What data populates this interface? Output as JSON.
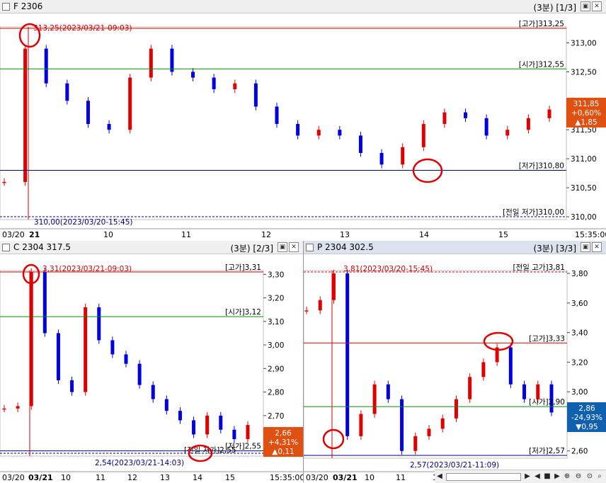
{
  "panels": {
    "top": {
      "name": "F 2306",
      "info": "(3분) [1/3]",
      "ylabels": [
        "313,00",
        "312,50",
        "312,00",
        "311,50",
        "311,00",
        "310,50",
        "310,00"
      ],
      "hlines": [
        {
          "label": "[고가]313,25",
          "value": 313.25,
          "color": "#d00000",
          "dash": false
        },
        {
          "label": "[시가]312,55",
          "value": 312.55,
          "color": "#009000",
          "dash": false
        },
        {
          "label": "[저가]310,80",
          "value": 310.8,
          "color": "#000080",
          "dash": false
        },
        {
          "label": "[전일 저가]310,00",
          "value": 310.0,
          "color": "#000080",
          "dash": true
        }
      ],
      "annotations": [
        "313,25(2023/03/21-09:03)",
        "310,00(2023/03/20-15:45)"
      ],
      "current": {
        "price": "311,85",
        "change": "+0,60%",
        "diff": "▲1,85"
      },
      "xlabels": [
        "03/20",
        "21",
        "10",
        "11",
        "12",
        "13",
        "14",
        "15",
        "15:35:00"
      ]
    },
    "c": {
      "name": "C 2304 317.5",
      "info": "(3분) [2/3]",
      "ylabels": [
        "3,30",
        "3,20",
        "3,10",
        "3,00",
        "2,90",
        "2,80",
        "2,70",
        "2,60"
      ],
      "hlines": [
        {
          "label": "[고가]3,31",
          "value": 3.31,
          "color": "#d00000",
          "dash": false
        },
        {
          "label": "[시가]3,12",
          "value": 3.12,
          "color": "#009000",
          "dash": false
        },
        {
          "label": "[저가]2,55",
          "value": 2.55,
          "color": "#000080",
          "dash": false
        },
        {
          "label": "",
          "value": 2.54,
          "color": "#000080",
          "dash": true
        }
      ],
      "annotations": [
        "3,31(2023/03/21-09:03)",
        "2,54(2023/03/21-14:03)",
        "[전일 저가]2,55"
      ],
      "current": {
        "price": "2,66",
        "change": "+4,31%",
        "diff": "▲0,11"
      },
      "xlabels": [
        "03/20",
        "03/21",
        "10",
        "11",
        "12",
        "13",
        "14",
        "15",
        "15:35:00"
      ]
    },
    "p": {
      "name": "P 2304 302.5",
      "info": "(3분) [3/3]",
      "ylabels": [
        "3,80",
        "3,60",
        "3,40",
        "3,20",
        "3,00",
        "2,80",
        "2,60"
      ],
      "hlines": [
        {
          "label": "[전일 고가]3,81",
          "value": 3.81,
          "color": "#d00000",
          "dash": true
        },
        {
          "label": "[고가]3,33",
          "value": 3.33,
          "color": "#d00000",
          "dash": false
        },
        {
          "label": "[시가]2,90",
          "value": 2.9,
          "color": "#009000",
          "dash": false
        },
        {
          "label": "[저가]2,57",
          "value": 2.57,
          "color": "#000080",
          "dash": false
        }
      ],
      "annotations": [
        "3,81(2023/03/20-15:45)",
        "2,57(2023/03/21-11:09)"
      ],
      "current": {
        "price": "2,86",
        "change": "-24,93%",
        "diff": "▼0,95"
      },
      "xlabels": [
        "03/20",
        "03/21",
        "10",
        "11",
        "12",
        "13",
        "14",
        "15"
      ]
    }
  },
  "colors": {
    "up": "#e00000",
    "down": "#0000e0",
    "high": "#d00000",
    "open": "#009000",
    "low": "#000080"
  },
  "chart_data": [
    {
      "type": "candlestick",
      "title": "F 2306",
      "timeframe": "3분",
      "y_range": [
        310.0,
        313.25
      ],
      "x": [
        "03/20",
        "21",
        "10",
        "11",
        "12",
        "13",
        "14",
        "15",
        "15:35:00"
      ],
      "series": [
        {
          "name": "close",
          "values": [
            310.6,
            312.9,
            312.3,
            312.0,
            311.6,
            311.5,
            312.4,
            312.9,
            312.5,
            312.4,
            312.2,
            312.3,
            311.9,
            311.6,
            311.4,
            311.5,
            311.4,
            311.1,
            310.9,
            311.2,
            311.6,
            311.8,
            311.7,
            311.4,
            311.5,
            311.7,
            311.85
          ]
        }
      ],
      "high": 313.25,
      "open": 312.55,
      "low": 310.8,
      "prev_low": 310.0,
      "last": 311.85,
      "change_pct": 0.6,
      "change": 1.85
    },
    {
      "type": "candlestick",
      "title": "C 2304 317.5",
      "timeframe": "3분",
      "y_range": [
        2.54,
        3.31
      ],
      "x": [
        "03/20",
        "03/21",
        "10",
        "11",
        "12",
        "13",
        "14",
        "15",
        "15:35:00"
      ],
      "series": [
        {
          "name": "close",
          "values": [
            2.73,
            2.74,
            3.31,
            3.05,
            2.85,
            2.8,
            3.16,
            3.02,
            2.96,
            2.92,
            2.83,
            2.77,
            2.72,
            2.68,
            2.62,
            2.7,
            2.64,
            2.6,
            2.66
          ]
        }
      ],
      "high": 3.31,
      "open": 3.12,
      "low": 2.55,
      "last": 2.66,
      "change_pct": 4.31,
      "change": 0.11
    },
    {
      "type": "candlestick",
      "title": "P 2304 302.5",
      "timeframe": "3분",
      "y_range": [
        2.57,
        3.81
      ],
      "x": [
        "03/20",
        "03/21",
        "10",
        "11",
        "12",
        "13",
        "14",
        "15"
      ],
      "series": [
        {
          "name": "close",
          "values": [
            3.55,
            3.62,
            3.8,
            2.7,
            2.85,
            3.05,
            2.95,
            2.6,
            2.7,
            2.75,
            2.82,
            2.95,
            3.1,
            3.2,
            3.3,
            3.05,
            2.95,
            3.05,
            2.86
          ]
        }
      ],
      "prev_high": 3.81,
      "high": 3.33,
      "open": 2.9,
      "low": 2.57,
      "last": 2.86,
      "change_pct": -24.93,
      "change": -0.95
    }
  ]
}
